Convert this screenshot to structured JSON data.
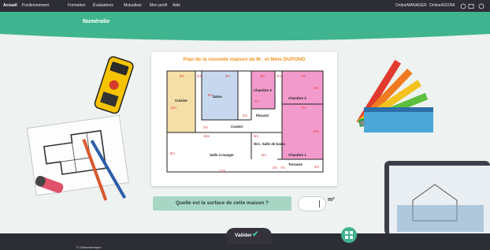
{
  "nav": {
    "items": [
      "Accueil",
      "Positionnement",
      "Formation",
      "Évaluations",
      "Mutualiser",
      "Mon profil",
      "Aide"
    ],
    "right": [
      "OnlineMANAGER",
      "OnlineAGORA"
    ]
  },
  "banner": {
    "title": "Numératie"
  },
  "plan": {
    "title": "Plan de la nouvelle maison de M . et Mme DUPOND",
    "rooms": [
      "Cuisine",
      "Salon",
      "Chambre 3",
      "Chambre 2",
      "Placard",
      "Couloir",
      "W.C. Salle de bains",
      "Salle à manger",
      "Chambre 1",
      "Terrasse"
    ],
    "dims": [
      "5m",
      "2m",
      "3m",
      "4m",
      "2m",
      "7m",
      "11m",
      "9m",
      "7m",
      "2m",
      "6m",
      "2m",
      "7m",
      "15m",
      "5m",
      "10m",
      "8m",
      "6m",
      "21m",
      "3m",
      "7m",
      "3m"
    ]
  },
  "question": {
    "text": "Quelle est la surface de cette maison ?",
    "value": "",
    "unit": "m²"
  },
  "footer": {
    "validate": "Valider",
    "copyright": "© Onlineformapro"
  },
  "colors": {
    "accent": "#3fb48f",
    "dark": "#2d2d36",
    "question_bg": "#a8d6c5",
    "title_orange": "#f0941f"
  }
}
